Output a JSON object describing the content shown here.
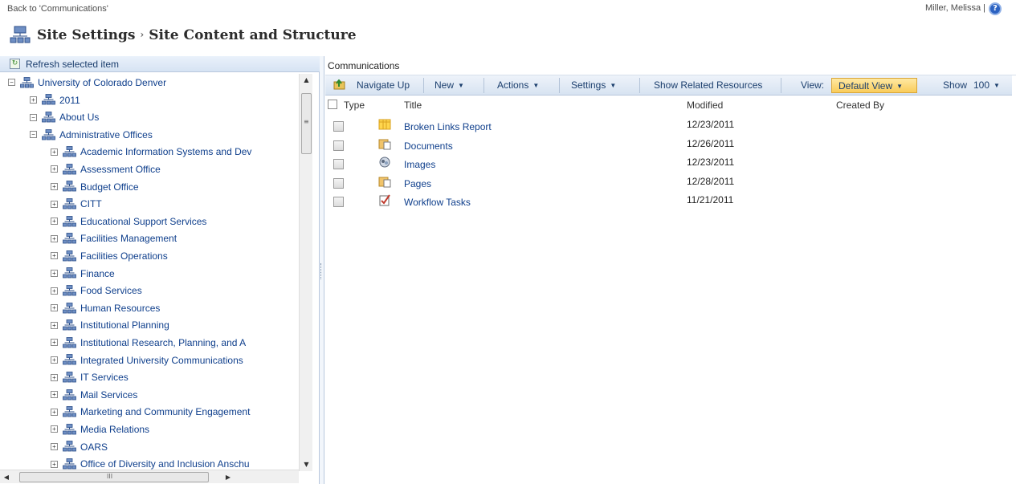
{
  "topbar": {
    "back_link": "Back to 'Communications'",
    "user": "Miller, Melissa  |"
  },
  "header": {
    "title_part1": "Site Settings",
    "separator": "›",
    "title_part2": "Site Content and Structure"
  },
  "left": {
    "refresh_label": "Refresh selected item",
    "tree": [
      {
        "label": "University of Colorado Denver",
        "expander": "−",
        "level": 0
      },
      {
        "label": "2011",
        "expander": "+",
        "level": 1
      },
      {
        "label": "About Us",
        "expander": "−",
        "level": 1
      },
      {
        "label": "Administrative Offices",
        "expander": "−",
        "level": 2
      },
      {
        "label": "Academic Information Systems and Dev",
        "expander": "+",
        "level": 3
      },
      {
        "label": "Assessment Office",
        "expander": "+",
        "level": 3
      },
      {
        "label": "Budget Office",
        "expander": "+",
        "level": 3
      },
      {
        "label": "CITT",
        "expander": "+",
        "level": 3
      },
      {
        "label": "Educational Support Services",
        "expander": "+",
        "level": 3
      },
      {
        "label": "Facilities Management",
        "expander": "+",
        "level": 3
      },
      {
        "label": "Facilities Operations",
        "expander": "+",
        "level": 3
      },
      {
        "label": "Finance",
        "expander": "+",
        "level": 3
      },
      {
        "label": "Food Services",
        "expander": "+",
        "level": 3
      },
      {
        "label": "Human Resources",
        "expander": "+",
        "level": 3
      },
      {
        "label": "Institutional Planning",
        "expander": "+",
        "level": 3
      },
      {
        "label": "Institutional Research, Planning, and A",
        "expander": "+",
        "level": 3
      },
      {
        "label": "Integrated University Communications",
        "expander": "+",
        "level": 3
      },
      {
        "label": "IT Services",
        "expander": "+",
        "level": 3
      },
      {
        "label": "Mail Services",
        "expander": "+",
        "level": 3
      },
      {
        "label": "Marketing and Community Engagement",
        "expander": "+",
        "level": 3
      },
      {
        "label": "Media Relations",
        "expander": "+",
        "level": 3
      },
      {
        "label": "OARS",
        "expander": "+",
        "level": 3
      },
      {
        "label": "Office of Diversity and Inclusion Anschu",
        "expander": "+",
        "level": 3
      }
    ],
    "scroll_thumb_grip": "≡",
    "hscroll_thumb_grip": "III"
  },
  "right": {
    "breadcrumb": "Communications",
    "toolbar": {
      "navigate_up": "Navigate Up",
      "new": "New",
      "actions": "Actions",
      "settings": "Settings",
      "show_related": "Show Related Resources",
      "view_label": "View:",
      "view_value": "Default View",
      "show_label": "Show",
      "show_value": "100"
    },
    "columns": {
      "type": "Type",
      "title": "Title",
      "modified": "Modified",
      "created_by": "Created By"
    },
    "rows": [
      {
        "type_icon": "list-icon",
        "title": "Broken Links Report",
        "modified": "12/23/2011"
      },
      {
        "type_icon": "document-library-icon",
        "title": "Documents",
        "modified": "12/26/2011"
      },
      {
        "type_icon": "image-library-icon",
        "title": "Images",
        "modified": "12/23/2011"
      },
      {
        "type_icon": "pages-library-icon",
        "title": "Pages",
        "modified": "12/28/2011"
      },
      {
        "type_icon": "tasks-icon",
        "title": "Workflow Tasks",
        "modified": "11/21/2011"
      }
    ]
  }
}
